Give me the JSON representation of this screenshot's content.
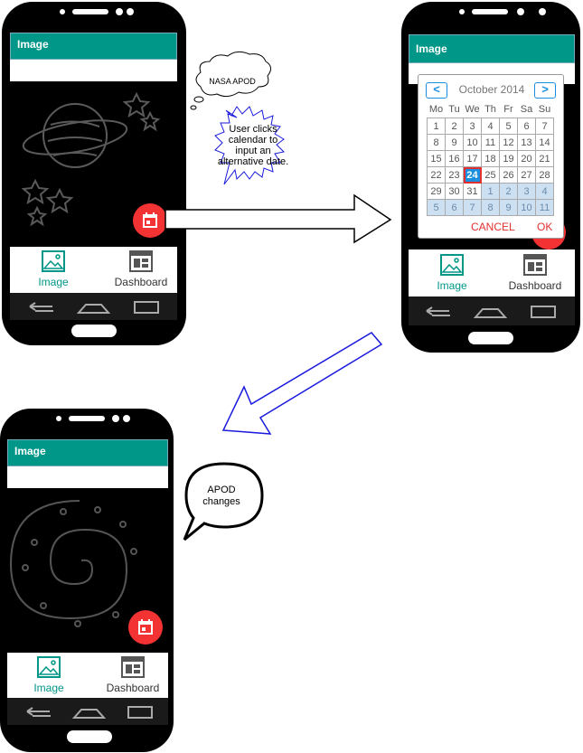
{
  "phones": {
    "appbar_title": "Image",
    "nav_image_label": "Image",
    "nav_dashboard_label": "Dashboard"
  },
  "callouts": {
    "cloud_text": "NASA APOD",
    "burst_text": "User clicks calendar to input an alternative date.",
    "speech_text": "APOD changes"
  },
  "calendar": {
    "month_label": "October 2014",
    "prev_label": "<",
    "next_label": ">",
    "weekdays": [
      "Mo",
      "Tu",
      "We",
      "Th",
      "Fr",
      "Sa",
      "Su"
    ],
    "weeks": [
      [
        {
          "d": "1"
        },
        {
          "d": "2"
        },
        {
          "d": "3"
        },
        {
          "d": "4"
        },
        {
          "d": "5"
        },
        {
          "d": "6"
        },
        {
          "d": "7"
        }
      ],
      [
        {
          "d": "8"
        },
        {
          "d": "9"
        },
        {
          "d": "10"
        },
        {
          "d": "11"
        },
        {
          "d": "12"
        },
        {
          "d": "13"
        },
        {
          "d": "14"
        }
      ],
      [
        {
          "d": "15"
        },
        {
          "d": "16"
        },
        {
          "d": "17"
        },
        {
          "d": "18"
        },
        {
          "d": "19"
        },
        {
          "d": "20"
        },
        {
          "d": "21"
        }
      ],
      [
        {
          "d": "22"
        },
        {
          "d": "23"
        },
        {
          "d": "24",
          "sel": true
        },
        {
          "d": "25"
        },
        {
          "d": "26"
        },
        {
          "d": "27"
        },
        {
          "d": "28"
        }
      ],
      [
        {
          "d": "29"
        },
        {
          "d": "30"
        },
        {
          "d": "31"
        },
        {
          "d": "1",
          "o": true
        },
        {
          "d": "2",
          "o": true
        },
        {
          "d": "3",
          "o": true
        },
        {
          "d": "4",
          "o": true
        }
      ],
      [
        {
          "d": "5",
          "o": true
        },
        {
          "d": "6",
          "o": true
        },
        {
          "d": "7",
          "o": true
        },
        {
          "d": "8",
          "o": true
        },
        {
          "d": "9",
          "o": true
        },
        {
          "d": "10",
          "o": true
        },
        {
          "d": "11",
          "o": true
        }
      ]
    ],
    "cancel_label": "CANCEL",
    "ok_label": "OK"
  },
  "colors": {
    "appbar": "#009688",
    "fab": "#f33333",
    "accent": "#1a8fe0",
    "arrow_blue": "#1a1adf"
  }
}
